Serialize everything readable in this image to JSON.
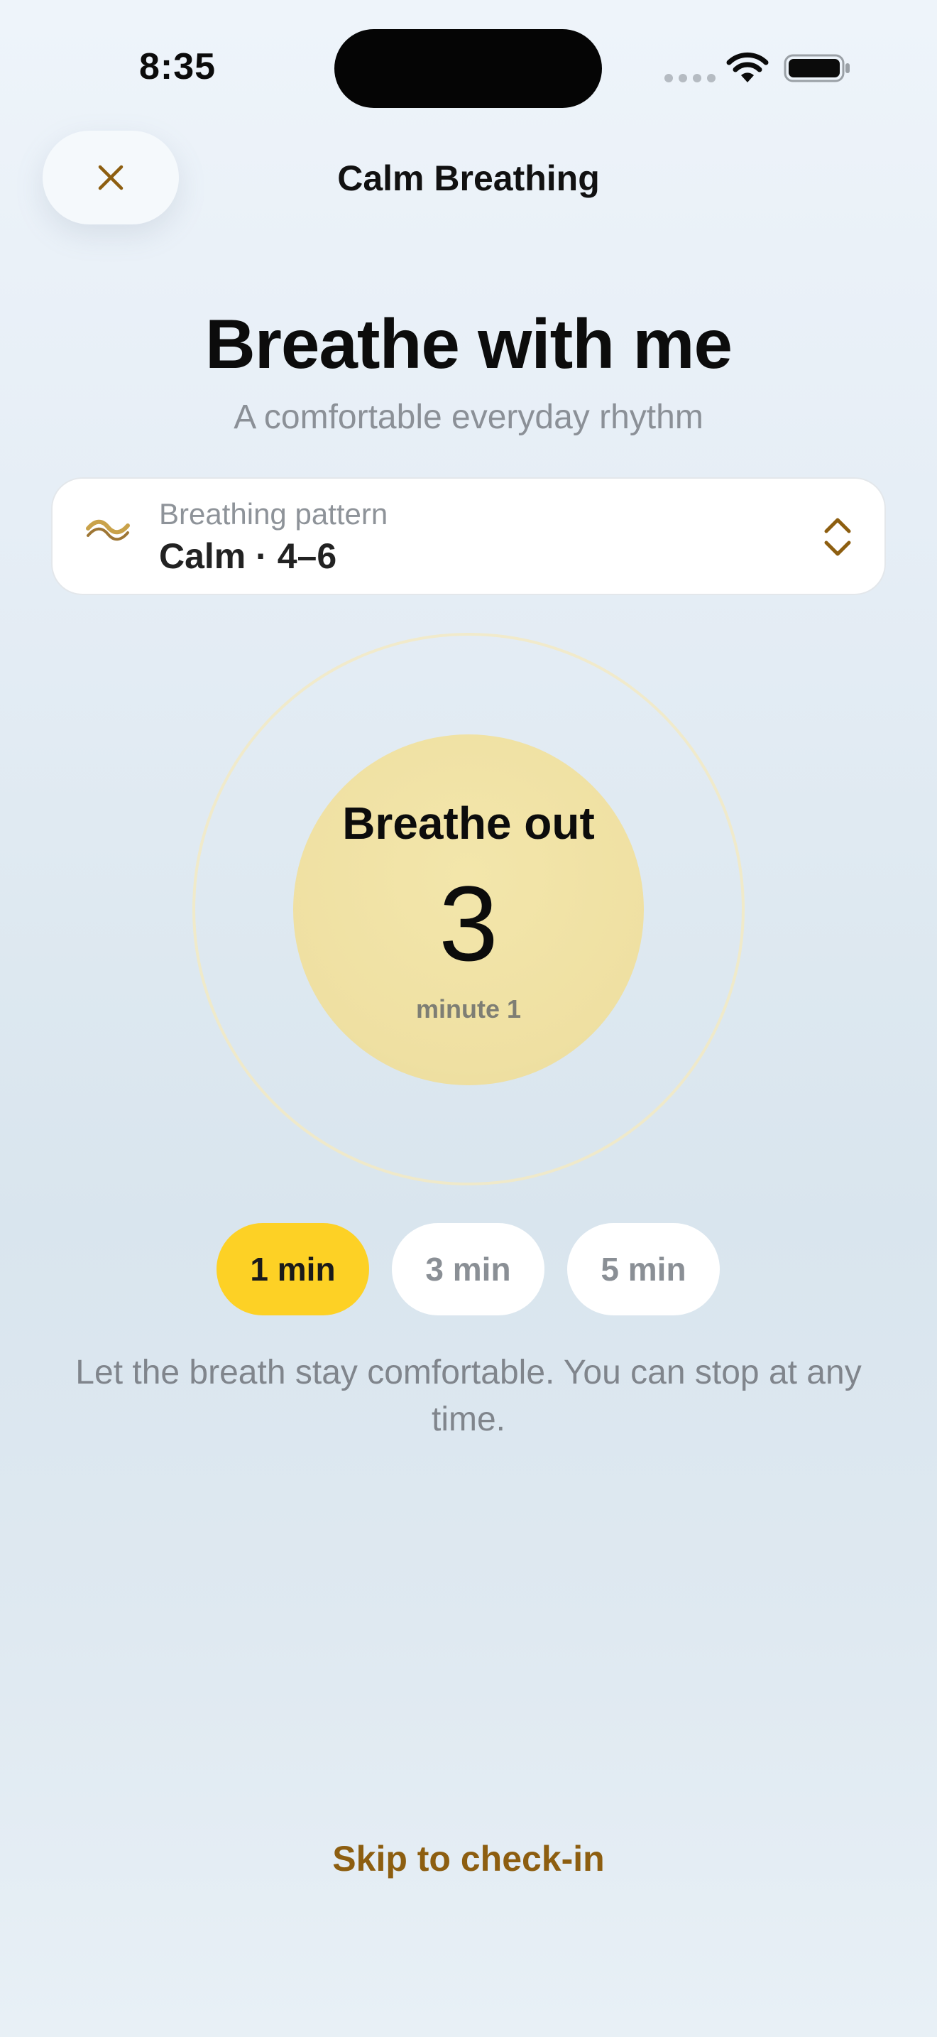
{
  "status_bar": {
    "time": "8:35",
    "icons": [
      "signal-dots-icon",
      "wifi-icon",
      "battery-icon"
    ]
  },
  "nav": {
    "close_icon": "close-icon",
    "title": "Calm Breathing"
  },
  "header": {
    "headline": "Breathe with me",
    "subhead": "A comfortable everyday rhythm"
  },
  "pattern": {
    "icon": "wave-icon",
    "label": "Breathing pattern",
    "value": "Calm · 4–6",
    "chevron_icon": "chevron-updown-icon"
  },
  "breath": {
    "phase": "Breathe out",
    "count": "3",
    "minute": "minute 1"
  },
  "durations": [
    {
      "label": "1 min",
      "selected": true
    },
    {
      "label": "3 min",
      "selected": false
    },
    {
      "label": "5 min",
      "selected": false
    }
  ],
  "hint": "Let the breath stay comfortable. You can stop at any time.",
  "skip_label": "Skip to check-in",
  "colors": {
    "accent": "#fdd125",
    "accent_text": "#8d5e10",
    "circle": "#efe0a2",
    "background": "#e6eef6"
  }
}
